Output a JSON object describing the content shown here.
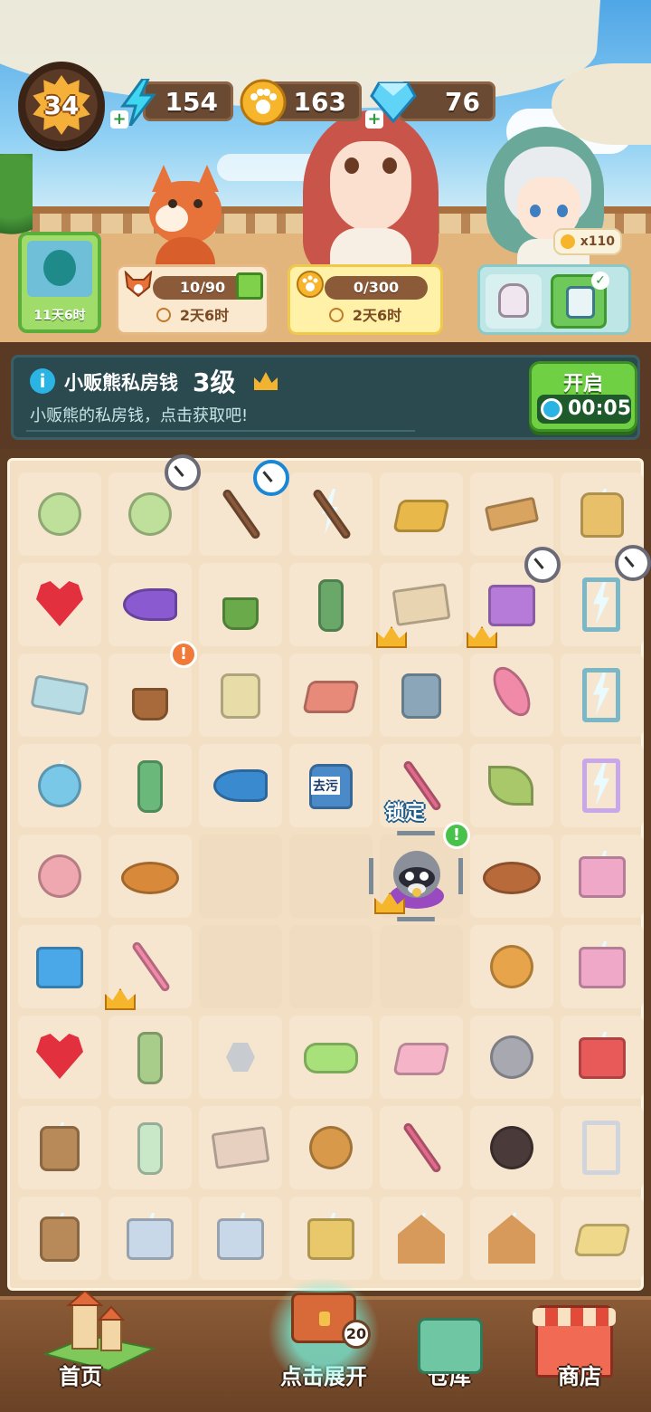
{
  "hud": {
    "level": "34",
    "energy": "154",
    "paws": "163",
    "gems": "76"
  },
  "events": {
    "avatar_timer": "11天6时",
    "event1_progress": "10/90",
    "event1_timer": "2天6时",
    "event2_progress": "0/300",
    "event2_timer": "2天6时",
    "paw_count": "x110"
  },
  "info": {
    "title": "小贩熊私房钱",
    "level": "3级",
    "description": "小贩熊的私房钱，点击获取吧!",
    "open_label": "开启",
    "open_timer": "00:05"
  },
  "board": {
    "lock_label": "锁定",
    "alert_symbol": "!",
    "detergent_label": "去污"
  },
  "nav": {
    "home": "首页",
    "expand": "点击展开",
    "expand_count": "20",
    "warehouse": "仓库",
    "shop": "商店"
  },
  "colors": {
    "board_bg": "#f3dfc4",
    "cell_bg": "#f7e6cf",
    "accent_green": "#6fd044",
    "info_bg": "#2a4a50"
  }
}
